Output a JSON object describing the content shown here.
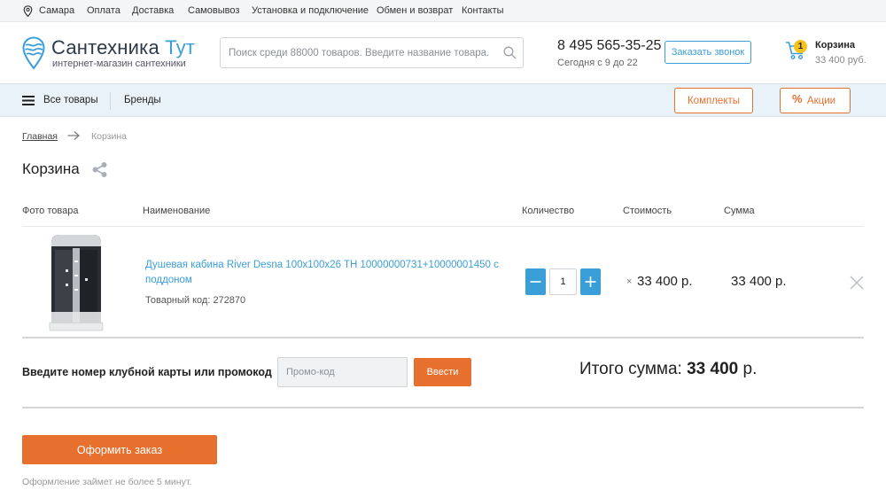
{
  "topbar": {
    "city": "Самара",
    "links": [
      "Оплата",
      "Доставка",
      "Самовывоз",
      "Установка и подключение",
      "Обмен и возврат",
      "Контакты"
    ]
  },
  "header": {
    "logo_title_main": "Сантехника",
    "logo_title_accent": "Тут",
    "logo_subtitle": "интернет-магазин сантехники",
    "search_placeholder": "Поиск среди 88000 товаров. Введите название товара.",
    "phone": "8 495 565-35-25",
    "hours": "Сегодня с 9 до 22",
    "callback_label": "Заказать звонок",
    "cart": {
      "count": "1",
      "label": "Корзина",
      "total": "33 400 руб."
    }
  },
  "nav": {
    "all_goods": "Все товары",
    "brands": "Бренды",
    "kits": "Комплекты",
    "sales": "Акции"
  },
  "breadcrumb": {
    "home": "Главная",
    "current": "Корзина"
  },
  "page_title": "Корзина",
  "table": {
    "headers": {
      "photo": "Фото товара",
      "name": "Наименование",
      "qty": "Количество",
      "price": "Стоимость",
      "sum": "Сумма"
    },
    "items": [
      {
        "name": "Душевая кабина River Desna 100x100x26 TH 10000000731+10000001450 с поддоном",
        "code": "Товарный код: 272870",
        "qty": "1",
        "price_prefix": "×",
        "price": "33 400 р.",
        "sum": "33 400 р."
      }
    ]
  },
  "promo": {
    "label": "Введите номер клубной карты или промокод",
    "placeholder": "Промо-код",
    "apply_label": "Ввести"
  },
  "total": {
    "label": "Итого сумма:",
    "value": "33 400",
    "currency": "р."
  },
  "order": {
    "button_label": "Оформить заказ",
    "note": "Оформление займет не более 5 минут."
  },
  "colors": {
    "accent_blue": "#3a9fd8",
    "accent_orange": "#e8702f",
    "badge_yellow": "#f5c21b",
    "nav_bg": "#eaf2f9"
  },
  "icons": [
    "location-pin-icon",
    "logo-drop-icon",
    "search-icon",
    "cart-icon",
    "menu-icon",
    "percent-icon",
    "arrow-right-icon",
    "share-icon",
    "minus-icon",
    "plus-icon",
    "close-icon"
  ]
}
